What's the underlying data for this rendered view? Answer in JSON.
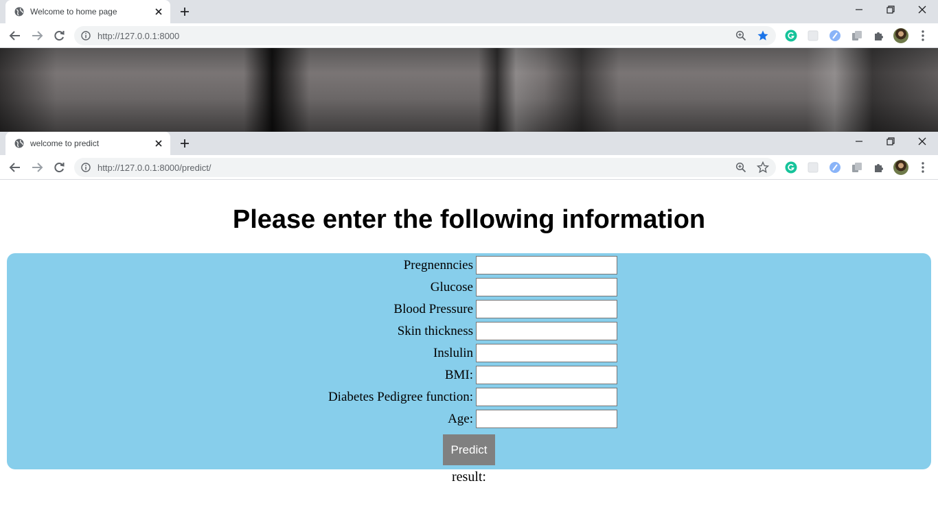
{
  "browser_back": {
    "tab_title": "Welcome to home page",
    "url": "http://127.0.0.1:8000",
    "bookmarked": true
  },
  "browser_front": {
    "tab_title": "welcome to predict",
    "url": "http://127.0.0.1:8000/predict/",
    "bookmarked": false
  },
  "colors": {
    "form_background": "#87ceeb",
    "button_background": "#808080",
    "star_active": "#1a73e8",
    "grammarly": "#15c39a"
  },
  "icons": [
    "globe-icon",
    "close-icon",
    "plus-icon",
    "minimize-icon",
    "restore-icon",
    "back-icon",
    "forward-icon",
    "reload-icon",
    "info-icon",
    "zoom-icon",
    "star-icon",
    "grammarly-icon",
    "extension-icon",
    "puzzle-icon",
    "menu-icon"
  ],
  "page": {
    "heading": "Please enter the following information",
    "fields": [
      {
        "label": "Pregnenncies",
        "value": ""
      },
      {
        "label": "Glucose",
        "value": ""
      },
      {
        "label": "Blood Pressure",
        "value": ""
      },
      {
        "label": "Skin thickness",
        "value": ""
      },
      {
        "label": "Inslulin",
        "value": ""
      },
      {
        "label": "BMI:",
        "value": ""
      },
      {
        "label": "Diabetes Pedigree function:",
        "value": ""
      },
      {
        "label": "Age:",
        "value": ""
      }
    ],
    "predict_label": "Predict",
    "result_label": "result:"
  }
}
